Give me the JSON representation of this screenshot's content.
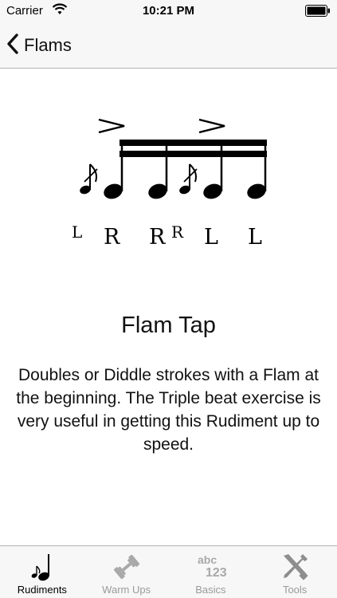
{
  "status_bar": {
    "carrier": "Carrier",
    "time": "10:21 PM"
  },
  "nav": {
    "back_label": "Flams"
  },
  "rudiment": {
    "sticking": [
      "L",
      "R",
      "R",
      "R",
      "L",
      "L"
    ],
    "title": "Flam Tap",
    "description": "Doubles or Diddle strokes with a Flam at the beginning.  The Triple beat exercise is very useful in getting this Rudiment up to speed."
  },
  "tabs": [
    {
      "label": "Rudiments",
      "icon": "music-note-icon",
      "active": true
    },
    {
      "label": "Warm Ups",
      "icon": "dumbbell-icon",
      "active": false
    },
    {
      "label": "Basics",
      "icon": "abc-123-icon",
      "active": false
    },
    {
      "label": "Tools",
      "icon": "tools-icon",
      "active": false
    }
  ],
  "colors": {
    "bar_background": "#f7f7f7",
    "inactive_tab": "#9a9a9a"
  }
}
